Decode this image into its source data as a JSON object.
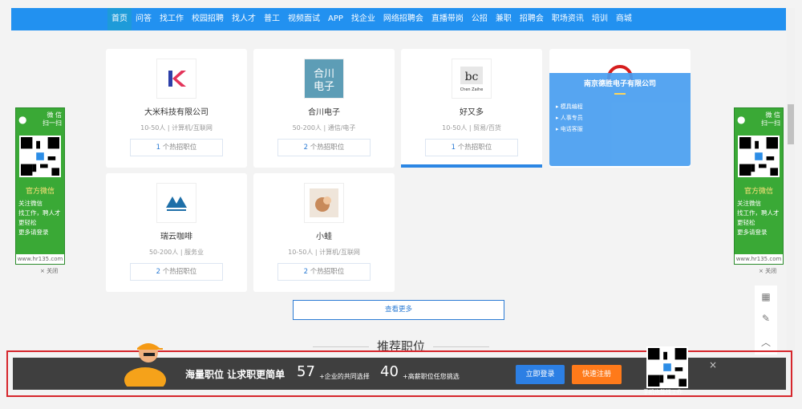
{
  "nav": {
    "items": [
      "首页",
      "问答",
      "找工作",
      "校园招聘",
      "找人才",
      "普工",
      "视频面试",
      "APP",
      "找企业",
      "网络招聘会",
      "直播带岗",
      "公招",
      "兼职",
      "招聘会",
      "职场资讯",
      "培训",
      "商城"
    ],
    "active_index": 0
  },
  "companies": [
    {
      "name": "大米科技有限公司",
      "meta": "10-50人 | 计算机/互联网",
      "jobs_count": "1",
      "jobs_suffix": "个热招职位"
    },
    {
      "name": "合川电子",
      "meta": "50-200人 | 通信/电子",
      "jobs_count": "2",
      "jobs_suffix": "个热招职位",
      "logo_text": "合川\n电子"
    },
    {
      "name": "好又多",
      "meta": "10-50人 | 贸易/百货",
      "jobs_count": "1",
      "jobs_suffix": "个热招职位",
      "logo_text": "Chen Zaihe"
    },
    {
      "name": "瑞云咖啡",
      "meta": "50-200人 | 服务业",
      "jobs_count": "2",
      "jobs_suffix": "个热招职位"
    },
    {
      "name": "小蛙",
      "meta": "10-50人 | 计算机/互联网",
      "jobs_count": "2",
      "jobs_suffix": "个热招职位"
    }
  ],
  "hover_card": {
    "title": "南京德胜电子有限公司",
    "jobs": [
      "模具编程",
      "人事专员",
      "电话客服"
    ]
  },
  "more_button": "查看更多",
  "recommend_title": "推荐职位",
  "side_ad": {
    "head_line1": "微 信",
    "head_line2": "扫一扫",
    "title": "官方微信",
    "text": [
      "关注微信",
      "找工作，聘人才",
      "更轻松",
      "更多请登录"
    ],
    "url": "www.hr135.com",
    "close": "× 关闭"
  },
  "banner": {
    "slogan": "海量职位 让求职更简单",
    "num1": "57",
    "label1": "+企业的共同选择",
    "num2": "40",
    "label2": "+高薪职位任您挑选",
    "login": "立即登录",
    "register": "快速注册",
    "qr_caption": "手机也能找工作",
    "close": "×"
  },
  "colors": {
    "nav": "#2291f0",
    "ad": "#3aa936",
    "login": "#2c7fe4",
    "register": "#ff7a1a",
    "border": "#d6262c"
  }
}
